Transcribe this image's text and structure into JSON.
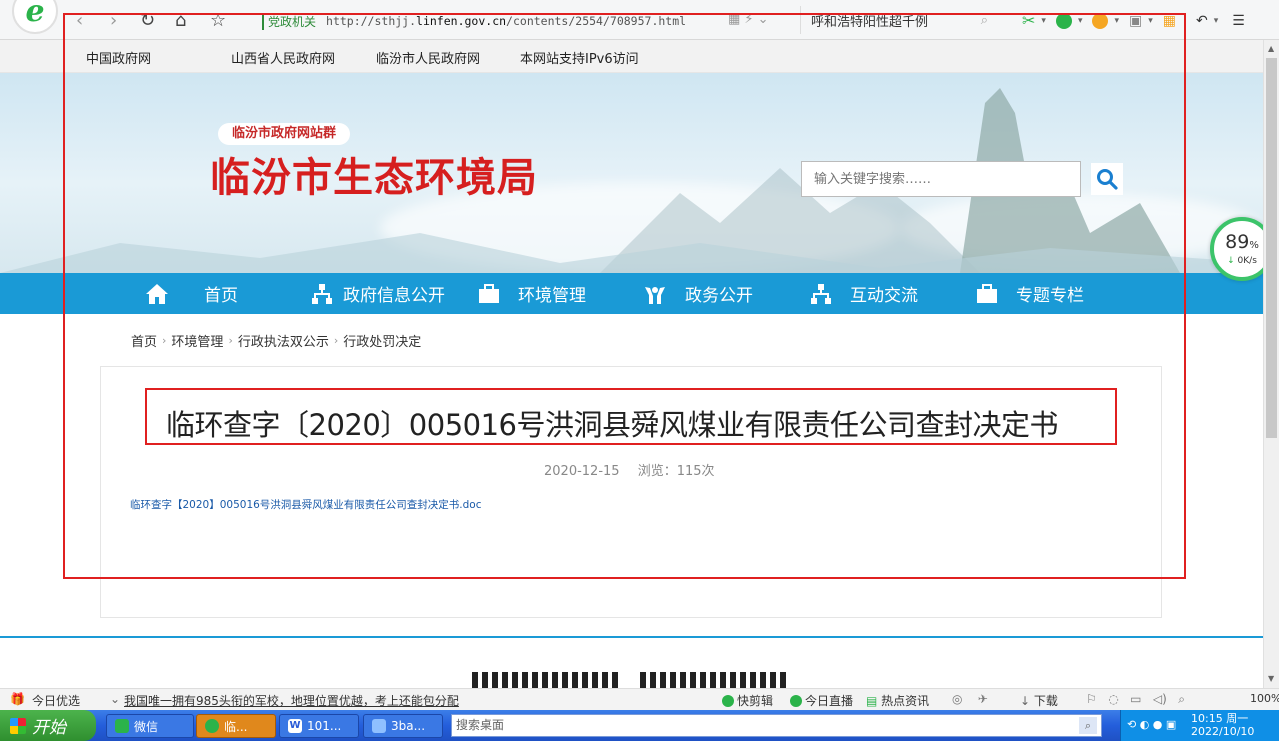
{
  "browser": {
    "url_badge": "党政机关",
    "url_prefix": "http://sthjj.",
    "url_domain": "linfen.gov.cn",
    "url_path": "/contents/2554/708957.html",
    "search_text": "呼和浩特阳性超千例"
  },
  "top_links": [
    "中国政府网",
    "山西省人民政府网",
    "临汾市人民政府网",
    "本网站支持IPv6访问"
  ],
  "header": {
    "group_badge": "临汾市政府网站群",
    "site_title": "临汾市生态环境局",
    "search_placeholder": "输入关键字搜索……"
  },
  "nav": [
    {
      "label": "首页",
      "icon": "home-icon"
    },
    {
      "label": "政府信息公开",
      "icon": "sitemap-icon"
    },
    {
      "label": "环境管理",
      "icon": "briefcase-icon"
    },
    {
      "label": "政务公开",
      "icon": "hands-icon"
    },
    {
      "label": "互动交流",
      "icon": "sitemap-icon"
    },
    {
      "label": "专题专栏",
      "icon": "briefcase-icon"
    }
  ],
  "speed_widget": {
    "percent": "89",
    "unit": "%",
    "rate": "0K/s"
  },
  "breadcrumb": [
    "首页",
    "环境管理",
    "行政执法双公示",
    "行政处罚决定"
  ],
  "article": {
    "title": "临环查字〔2020〕005016号洪洞县舜风煤业有限责任公司查封决定书",
    "date": "2020-12-15",
    "views": "浏览：115次",
    "attachment": "临环查字【2020】005016号洪洞县舜风煤业有限责任公司查封决定书.doc"
  },
  "status_bar": {
    "today_pick": "今日优选",
    "news": "我国唯一拥有985头衔的军校，地理位置优越，考上还能包分配",
    "quick_clip": "快剪辑",
    "today_live": "今日直播",
    "hot_news": "热点资讯",
    "download": "下载",
    "zoom": "100%"
  },
  "taskbar": {
    "start": "开始",
    "tasks": [
      "微信",
      "临...",
      "101...",
      "3ba..."
    ],
    "desktop_search": "搜索桌面",
    "time": "10:15 周一",
    "date": "2022/10/10"
  },
  "colors": {
    "nav_blue": "#1a9ad6",
    "title_red": "#d61f1f",
    "annotation_red": "#e02020"
  }
}
